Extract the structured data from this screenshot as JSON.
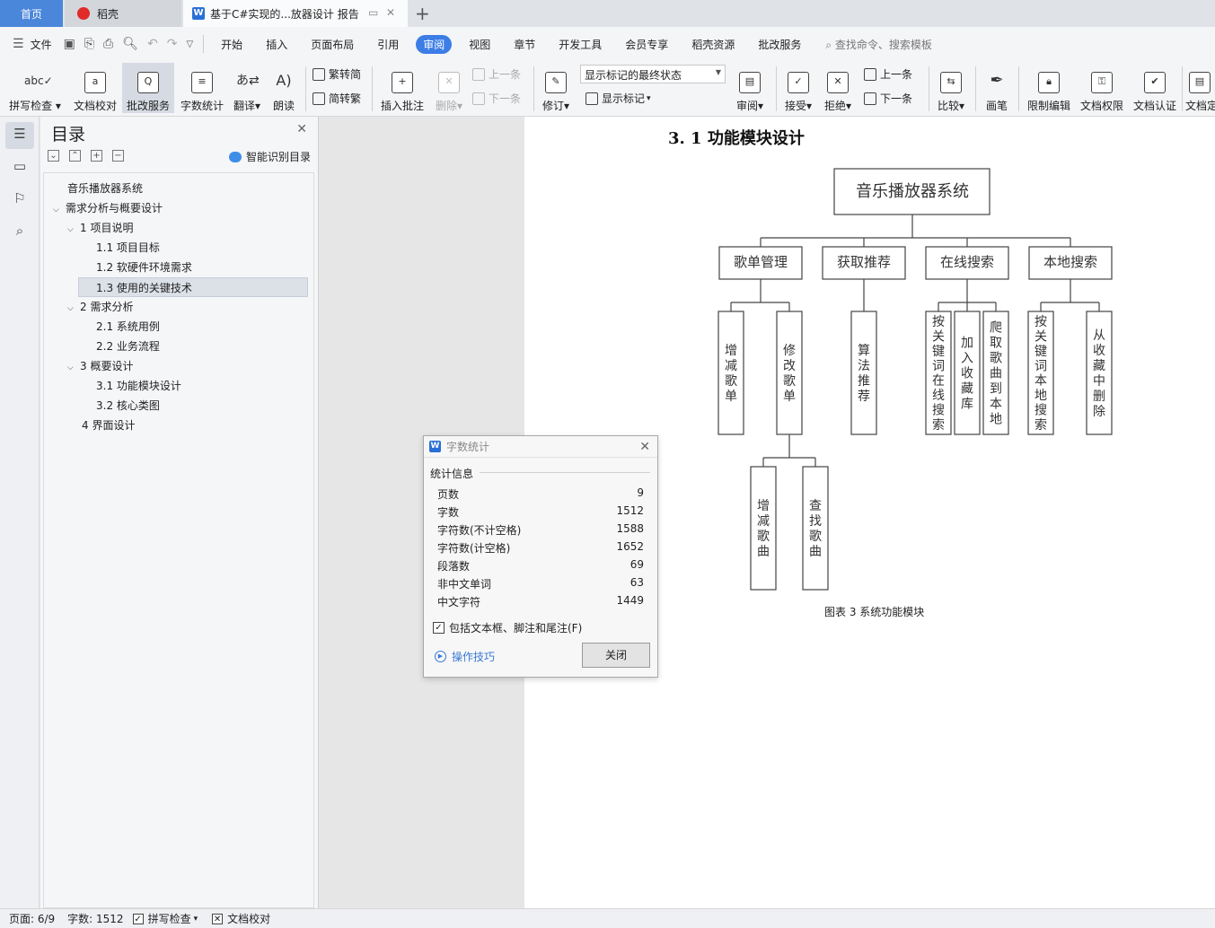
{
  "tabs": {
    "home": "首页",
    "daoke": "稻壳",
    "doc": "基于C#实现的...放器设计 报告"
  },
  "menu": {
    "file": "文件",
    "items": [
      "开始",
      "插入",
      "页面布局",
      "引用",
      "审阅",
      "视图",
      "章节",
      "开发工具",
      "会员专享",
      "稻壳资源",
      "批改服务"
    ],
    "active": "审阅",
    "search": "查找命令、搜索模板"
  },
  "ribbon": {
    "spellcheck": "拼写检查",
    "doc_check": "文档校对",
    "correction": "批改服务",
    "word_count": "字数统计",
    "translate": "翻译",
    "read_aloud": "朗读",
    "trad_to_simp": "繁转简",
    "simp_to_trad": "简转繁",
    "insert_comment": "插入批注",
    "delete": "删除",
    "prev_comment": "上一条",
    "next_comment": "下一条",
    "revise": "修订",
    "markup_state": "显示标记的最终状态",
    "show_markup": "显示标记",
    "review": "审阅",
    "accept": "接受",
    "reject": "拒绝",
    "prev_change": "上一条",
    "next_change": "下一条",
    "compare": "比较",
    "pen": "画笔",
    "restrict_edit": "限制编辑",
    "doc_permission": "文档权限",
    "doc_cert": "文档认证",
    "doc_more": "文档定"
  },
  "toc": {
    "title": "目录",
    "smart": "智能识别目录",
    "items": [
      {
        "text": "音乐播放器系统",
        "arrow": ""
      },
      {
        "text": "需求分析与概要设计",
        "arrow": "v"
      },
      {
        "text": "1  项目说明",
        "arrow": "v"
      },
      {
        "text": "1.1  项目目标",
        "arrow": ""
      },
      {
        "text": "1.2  软硬件环境需求",
        "arrow": ""
      },
      {
        "text": "1.3  使用的关键技术",
        "arrow": ""
      },
      {
        "text": "2  需求分析",
        "arrow": "v"
      },
      {
        "text": "2.1  系统用例",
        "arrow": ""
      },
      {
        "text": "2.2  业务流程",
        "arrow": ""
      },
      {
        "text": "3  概要设计",
        "arrow": "v"
      },
      {
        "text": "3.1  功能模块设计",
        "arrow": ""
      },
      {
        "text": "3.2  核心类图",
        "arrow": ""
      },
      {
        "text": "4  界面设计",
        "arrow": ""
      }
    ]
  },
  "document": {
    "heading": "3. 1  功能模块设计",
    "diagram": {
      "root": "音乐播放器系统",
      "level1": [
        "歌单管理",
        "获取推荐",
        "在线搜索",
        "本地搜索"
      ],
      "level2": [
        "增减歌单",
        "修改歌单",
        "算法推荐",
        "按关键词在线搜索",
        "加入收藏库",
        "爬取歌曲到本地",
        "按关键词本地搜索",
        "从收藏中删除"
      ],
      "level3": [
        "增减歌曲",
        "查找歌曲"
      ]
    },
    "caption": "图表 3 系统功能模块"
  },
  "dialog": {
    "title": "字数统计",
    "group": "统计信息",
    "stats": [
      {
        "label": "页数",
        "value": "9"
      },
      {
        "label": "字数",
        "value": "1512"
      },
      {
        "label": "字符数(不计空格)",
        "value": "1588"
      },
      {
        "label": "字符数(计空格)",
        "value": "1652"
      },
      {
        "label": "段落数",
        "value": "69"
      },
      {
        "label": "非中文单词",
        "value": "63"
      },
      {
        "label": "中文字符",
        "value": "1449"
      }
    ],
    "include_label": "包括文本框、脚注和尾注(F)",
    "include_checked": true,
    "tips": "操作技巧",
    "close_btn": "关闭"
  },
  "status": {
    "page": "页面: 6/9",
    "words": "字数: 1512",
    "spell": "拼写检查",
    "proof": "文档校对"
  },
  "colors": {
    "accent": "#3c7de6",
    "home_tab": "#4a86d9",
    "link": "#3a78d4"
  }
}
